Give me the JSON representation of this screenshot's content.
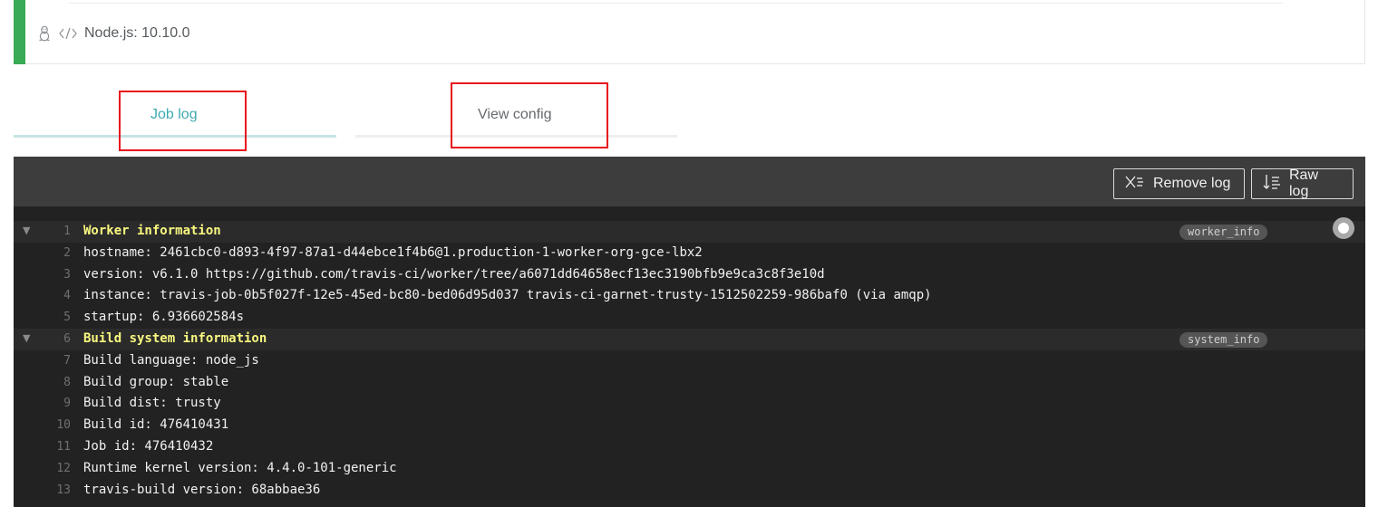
{
  "job": {
    "runtime_label": "Node.js: 10.10.0",
    "state_color": "#39aa56"
  },
  "tabs": [
    {
      "label": "Job log",
      "active": true
    },
    {
      "label": "View config",
      "active": false
    }
  ],
  "toolbar": {
    "remove_log_label": "Remove log",
    "raw_log_label": "Raw log"
  },
  "icons": {
    "os": "linux-penguin-icon",
    "language": "code-brackets-icon",
    "remove_log": "remove-log-icon",
    "raw_log": "raw-log-icon",
    "fold": "triangle-down-icon",
    "autoscroll": "autoscroll-toggle-icon"
  },
  "log": {
    "lines": [
      {
        "num": "1",
        "text": "Worker information",
        "header": true,
        "fold": "worker_info"
      },
      {
        "num": "2",
        "text": "hostname: 2461cbc0-d893-4f97-87a1-d44ebce1f4b6@1.production-1-worker-org-gce-lbx2"
      },
      {
        "num": "3",
        "text": "version: v6.1.0 https://github.com/travis-ci/worker/tree/a6071dd64658ecf13ec3190bfb9e9ca3c8f3e10d"
      },
      {
        "num": "4",
        "text": "instance: travis-job-0b5f027f-12e5-45ed-bc80-bed06d95d037 travis-ci-garnet-trusty-1512502259-986baf0 (via amqp)"
      },
      {
        "num": "5",
        "text": "startup: 6.936602584s"
      },
      {
        "num": "6",
        "text": "Build system information",
        "header": true,
        "fold": "system_info"
      },
      {
        "num": "7",
        "text": "Build language: node_js"
      },
      {
        "num": "8",
        "text": "Build group: stable"
      },
      {
        "num": "9",
        "text": "Build dist: trusty"
      },
      {
        "num": "10",
        "text": "Build id: 476410431"
      },
      {
        "num": "11",
        "text": "Job id: 476410432"
      },
      {
        "num": "12",
        "text": "Runtime kernel version: 4.4.0-101-generic"
      },
      {
        "num": "13",
        "text": "travis-build version: 68abbae36"
      }
    ]
  }
}
